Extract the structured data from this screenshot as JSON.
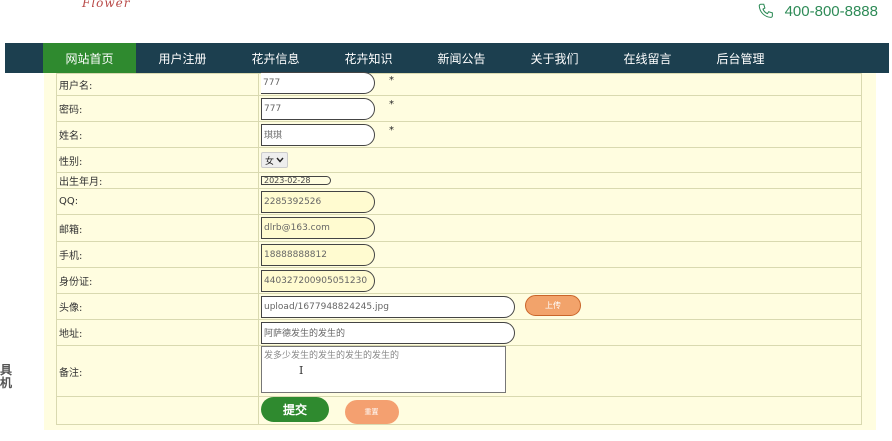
{
  "header": {
    "logo_text": "Flower",
    "phone": "400-800-8888"
  },
  "nav": {
    "items": [
      "网站首页",
      "用户注册",
      "花卉信息",
      "花卉知识",
      "新闻公告",
      "关于我们",
      "在线留言",
      "后台管理"
    ],
    "active_index": 0
  },
  "form": {
    "username": {
      "label": "用户名:",
      "value": "777",
      "required_mark": "*"
    },
    "password": {
      "label": "密码:",
      "value": "777",
      "required_mark": "*"
    },
    "realname": {
      "label": "姓名:",
      "value": "琪琪",
      "required_mark": "*"
    },
    "gender": {
      "label": "性别:",
      "value": "女"
    },
    "birthdate": {
      "label": "出生年月:",
      "value": "2023-02-28"
    },
    "qq": {
      "label": "QQ:",
      "value": "2285392526"
    },
    "email": {
      "label": "邮箱:",
      "value": "dlrb@163.com"
    },
    "phone": {
      "label": "手机:",
      "value": "18888888812"
    },
    "idcard": {
      "label": "身份证:",
      "value": "440327200905051230"
    },
    "avatar": {
      "label": "头像:",
      "value": "upload/1677948824245.jpg",
      "upload_label": "上传"
    },
    "address": {
      "label": "地址:",
      "value": "阿萨德发生的发生的"
    },
    "remark": {
      "label": "备注:",
      "value": "发多少发生的发生的发生的发生的"
    },
    "submit_label": "提交",
    "reset_label": "重置"
  },
  "side_glyph": "具\n机"
}
